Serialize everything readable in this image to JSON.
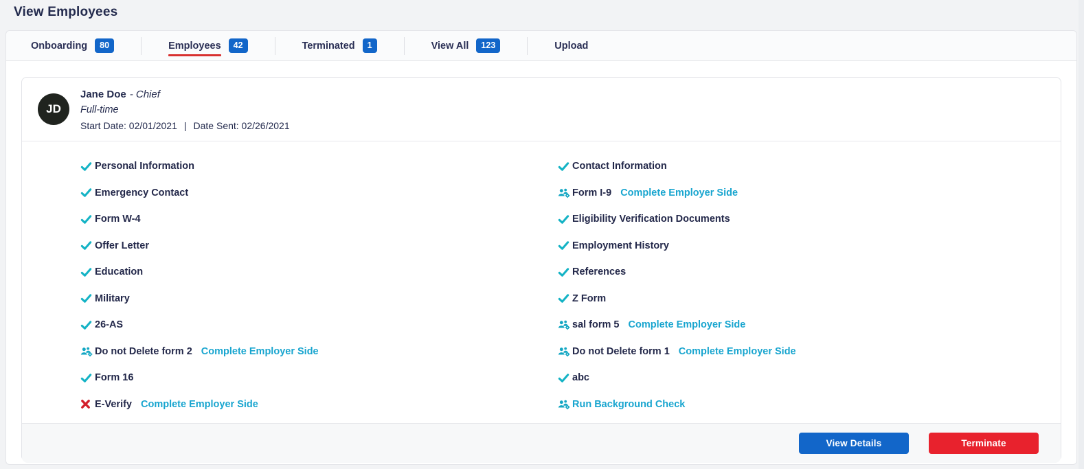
{
  "page": {
    "title": "View Employees"
  },
  "tabs": [
    {
      "label": "Onboarding",
      "count": "80",
      "active": false
    },
    {
      "label": "Employees",
      "count": "42",
      "active": true
    },
    {
      "label": "Terminated",
      "count": "1",
      "active": false
    },
    {
      "label": "View All",
      "count": "123",
      "active": false
    },
    {
      "label": "Upload",
      "count": null,
      "active": false
    }
  ],
  "employee": {
    "initials": "JD",
    "name": "Jane Doe",
    "role": "- Chief",
    "employment_type": "Full-time",
    "start_date": "Start Date: 02/01/2021",
    "separator": "|",
    "date_sent": "Date Sent: 02/26/2021"
  },
  "checklist": {
    "left": [
      {
        "label": "Personal Information",
        "status": "complete"
      },
      {
        "label": "Emergency Contact",
        "status": "complete"
      },
      {
        "label": "Form W-4",
        "status": "complete"
      },
      {
        "label": "Offer Letter",
        "status": "complete"
      },
      {
        "label": "Education",
        "status": "complete"
      },
      {
        "label": "Military",
        "status": "complete"
      },
      {
        "label": "26-AS",
        "status": "complete"
      },
      {
        "label": "Do not Delete form 2",
        "status": "employer",
        "link": "Complete Employer Side"
      },
      {
        "label": "Form 16",
        "status": "complete"
      },
      {
        "label": "E-Verify",
        "status": "incomplete",
        "link": "Complete Employer Side"
      }
    ],
    "right": [
      {
        "label": "Contact Information",
        "status": "complete"
      },
      {
        "label": "Form I-9",
        "status": "employer",
        "link": "Complete Employer Side"
      },
      {
        "label": "Eligibility Verification Documents",
        "status": "complete"
      },
      {
        "label": "Employment History",
        "status": "complete"
      },
      {
        "label": "References",
        "status": "complete"
      },
      {
        "label": "Z Form",
        "status": "complete"
      },
      {
        "label": "sal form 5",
        "status": "employer",
        "link": "Complete Employer Side"
      },
      {
        "label": "Do not Delete form 1",
        "status": "employer",
        "link": "Complete Employer Side"
      },
      {
        "label": "abc",
        "status": "complete"
      },
      {
        "label": "Run Background Check",
        "status": "employer-link"
      }
    ]
  },
  "actions": {
    "view_details": "View Details",
    "terminate": "Terminate"
  },
  "icon_map": {
    "complete": "check-icon",
    "incomplete": "x-icon",
    "employer": "users-gear-icon",
    "employer-link": "users-gear-icon"
  },
  "colors": {
    "badge_blue": "#1266c9",
    "primary_button": "#1266c9",
    "danger_button": "#e8222d",
    "check_teal": "#14b3c5",
    "x_red": "#d31f2b",
    "users_gear_teal": "#14a7c3",
    "link_cyan": "#18a5cf",
    "active_tab_underline": "#d8302f",
    "avatar_bg": "#20241f",
    "text_navy": "#232a4d"
  }
}
